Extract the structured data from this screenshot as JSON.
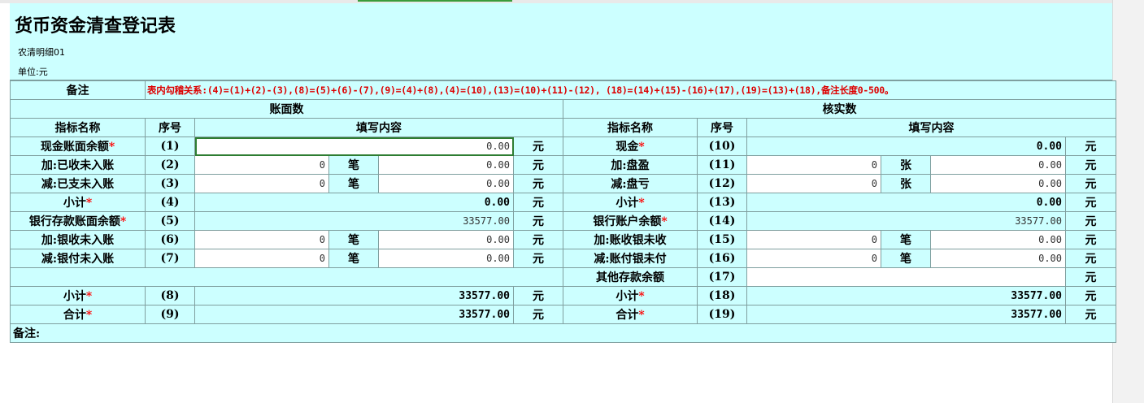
{
  "title": "货币资金清查登记表",
  "org": "农清明细01",
  "unit": "单位:元",
  "note_label": "备注",
  "note_text": "表内勾稽关系:(4)=(1)+(2)-(3),(8)=(5)+(6)-(7),(9)=(4)+(8),(4)=(10),(13)=(10)+(11)-(12), (18)=(14)+(15)-(16)+(17),(19)=(13)+(18),备注长度0-500。",
  "book_header": "账面数",
  "verified_header": "核实数",
  "col_name": "指标名称",
  "col_seq": "序号",
  "col_content": "填写内容",
  "req_mark": "*",
  "unit_yuan": "元",
  "unit_bi": "笔",
  "unit_zhang": "张",
  "rows": [
    {
      "lname": "现金账面余额",
      "lreq": true,
      "lseq": "(1)",
      "lval": "0.00",
      "rname": "现金",
      "rreq": true,
      "rseq": "(10)",
      "rval": "0.00"
    },
    {
      "lname": "加:已收未入账",
      "lseq": "(2)",
      "lcount": "0",
      "lval": "0.00",
      "rname": "加:盘盈",
      "rseq": "(11)",
      "rcount": "0",
      "rval": "0.00"
    },
    {
      "lname": "减:已支未入账",
      "lseq": "(3)",
      "lcount": "0",
      "lval": "0.00",
      "rname": "减:盘亏",
      "rseq": "(12)",
      "rcount": "0",
      "rval": "0.00"
    },
    {
      "lname": "小计",
      "lreq": true,
      "lseq": "(4)",
      "lval": "0.00",
      "rname": "小计",
      "rreq": true,
      "rseq": "(13)",
      "rval": "0.00"
    },
    {
      "lname": "银行存款账面余额",
      "lreq": true,
      "lseq": "(5)",
      "lval": "33577.00",
      "rname": "银行账户余额",
      "rreq": true,
      "rseq": "(14)",
      "rval": "33577.00"
    },
    {
      "lname": "加:银收未入账",
      "lseq": "(6)",
      "lcount": "0",
      "lval": "0.00",
      "rname": "加:账收银未收",
      "rseq": "(15)",
      "rcount": "0",
      "rval": "0.00"
    },
    {
      "lname": "减:银付未入账",
      "lseq": "(7)",
      "lcount": "0",
      "lval": "0.00",
      "rname": "减:账付银未付",
      "rseq": "(16)",
      "rcount": "0",
      "rval": "0.00"
    },
    {
      "rname": "其他存款余额",
      "rseq": "(17)",
      "rval": ""
    },
    {
      "lname": "小计",
      "lreq": true,
      "lseq": "(8)",
      "lval": "33577.00",
      "rname": "小计",
      "rreq": true,
      "rseq": "(18)",
      "rval": "33577.00"
    },
    {
      "lname": "合计",
      "lreq": true,
      "lseq": "(9)",
      "lval": "33577.00",
      "rname": "合计",
      "rreq": true,
      "rseq": "(19)",
      "rval": "33577.00"
    }
  ],
  "remark_label": "备注:"
}
